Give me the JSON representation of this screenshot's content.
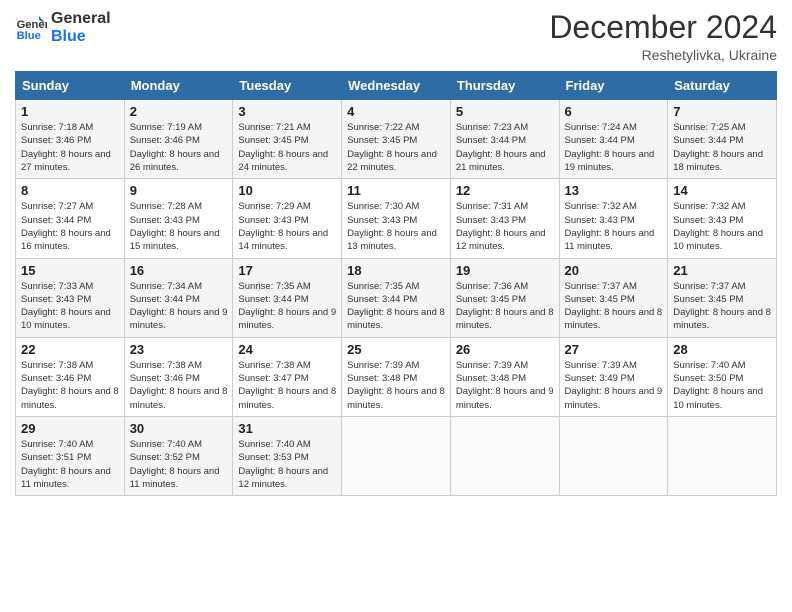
{
  "logo": {
    "line1": "General",
    "line2": "Blue"
  },
  "header": {
    "month": "December 2024",
    "location": "Reshetylivka, Ukraine"
  },
  "weekdays": [
    "Sunday",
    "Monday",
    "Tuesday",
    "Wednesday",
    "Thursday",
    "Friday",
    "Saturday"
  ],
  "weeks": [
    [
      {
        "day": "1",
        "sunrise": "7:18 AM",
        "sunset": "3:46 PM",
        "daylight": "8 hours and 27 minutes."
      },
      {
        "day": "2",
        "sunrise": "7:19 AM",
        "sunset": "3:46 PM",
        "daylight": "8 hours and 26 minutes."
      },
      {
        "day": "3",
        "sunrise": "7:21 AM",
        "sunset": "3:45 PM",
        "daylight": "8 hours and 24 minutes."
      },
      {
        "day": "4",
        "sunrise": "7:22 AM",
        "sunset": "3:45 PM",
        "daylight": "8 hours and 22 minutes."
      },
      {
        "day": "5",
        "sunrise": "7:23 AM",
        "sunset": "3:44 PM",
        "daylight": "8 hours and 21 minutes."
      },
      {
        "day": "6",
        "sunrise": "7:24 AM",
        "sunset": "3:44 PM",
        "daylight": "8 hours and 19 minutes."
      },
      {
        "day": "7",
        "sunrise": "7:25 AM",
        "sunset": "3:44 PM",
        "daylight": "8 hours and 18 minutes."
      }
    ],
    [
      {
        "day": "8",
        "sunrise": "7:27 AM",
        "sunset": "3:44 PM",
        "daylight": "8 hours and 16 minutes."
      },
      {
        "day": "9",
        "sunrise": "7:28 AM",
        "sunset": "3:43 PM",
        "daylight": "8 hours and 15 minutes."
      },
      {
        "day": "10",
        "sunrise": "7:29 AM",
        "sunset": "3:43 PM",
        "daylight": "8 hours and 14 minutes."
      },
      {
        "day": "11",
        "sunrise": "7:30 AM",
        "sunset": "3:43 PM",
        "daylight": "8 hours and 13 minutes."
      },
      {
        "day": "12",
        "sunrise": "7:31 AM",
        "sunset": "3:43 PM",
        "daylight": "8 hours and 12 minutes."
      },
      {
        "day": "13",
        "sunrise": "7:32 AM",
        "sunset": "3:43 PM",
        "daylight": "8 hours and 11 minutes."
      },
      {
        "day": "14",
        "sunrise": "7:32 AM",
        "sunset": "3:43 PM",
        "daylight": "8 hours and 10 minutes."
      }
    ],
    [
      {
        "day": "15",
        "sunrise": "7:33 AM",
        "sunset": "3:43 PM",
        "daylight": "8 hours and 10 minutes."
      },
      {
        "day": "16",
        "sunrise": "7:34 AM",
        "sunset": "3:44 PM",
        "daylight": "8 hours and 9 minutes."
      },
      {
        "day": "17",
        "sunrise": "7:35 AM",
        "sunset": "3:44 PM",
        "daylight": "8 hours and 9 minutes."
      },
      {
        "day": "18",
        "sunrise": "7:35 AM",
        "sunset": "3:44 PM",
        "daylight": "8 hours and 8 minutes."
      },
      {
        "day": "19",
        "sunrise": "7:36 AM",
        "sunset": "3:45 PM",
        "daylight": "8 hours and 8 minutes."
      },
      {
        "day": "20",
        "sunrise": "7:37 AM",
        "sunset": "3:45 PM",
        "daylight": "8 hours and 8 minutes."
      },
      {
        "day": "21",
        "sunrise": "7:37 AM",
        "sunset": "3:45 PM",
        "daylight": "8 hours and 8 minutes."
      }
    ],
    [
      {
        "day": "22",
        "sunrise": "7:38 AM",
        "sunset": "3:46 PM",
        "daylight": "8 hours and 8 minutes."
      },
      {
        "day": "23",
        "sunrise": "7:38 AM",
        "sunset": "3:46 PM",
        "daylight": "8 hours and 8 minutes."
      },
      {
        "day": "24",
        "sunrise": "7:38 AM",
        "sunset": "3:47 PM",
        "daylight": "8 hours and 8 minutes."
      },
      {
        "day": "25",
        "sunrise": "7:39 AM",
        "sunset": "3:48 PM",
        "daylight": "8 hours and 8 minutes."
      },
      {
        "day": "26",
        "sunrise": "7:39 AM",
        "sunset": "3:48 PM",
        "daylight": "8 hours and 9 minutes."
      },
      {
        "day": "27",
        "sunrise": "7:39 AM",
        "sunset": "3:49 PM",
        "daylight": "8 hours and 9 minutes."
      },
      {
        "day": "28",
        "sunrise": "7:40 AM",
        "sunset": "3:50 PM",
        "daylight": "8 hours and 10 minutes."
      }
    ],
    [
      {
        "day": "29",
        "sunrise": "7:40 AM",
        "sunset": "3:51 PM",
        "daylight": "8 hours and 11 minutes."
      },
      {
        "day": "30",
        "sunrise": "7:40 AM",
        "sunset": "3:52 PM",
        "daylight": "8 hours and 11 minutes."
      },
      {
        "day": "31",
        "sunrise": "7:40 AM",
        "sunset": "3:53 PM",
        "daylight": "8 hours and 12 minutes."
      },
      null,
      null,
      null,
      null
    ]
  ]
}
